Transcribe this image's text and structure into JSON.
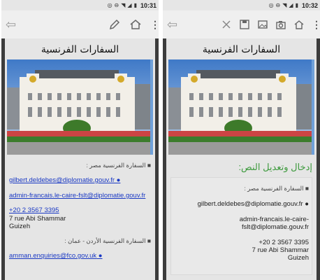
{
  "status": {
    "left_time": "10:31",
    "right_time": "10:32"
  },
  "left": {
    "title": "السفارات الفرنسية",
    "egypt_label": "■ السفارة الفرنسية مصر :",
    "email1": "gilbert.deldebes@diplomatie.gouv.fr",
    "email2": "admin-francais.le-caire-fslt@diplomatie.gouv.fr",
    "phone": "+20 2 3567 3395",
    "address1": "7 rue Abi Shammar",
    "address2": "Guizeh",
    "jordan_label": "■ السفارة الفرنسية الأردن - عمان :",
    "email3": "amman.enquiries@fco.gov.uk"
  },
  "right": {
    "title": "السفارات الفرنسية",
    "edit_title": "إدخال وتعديل النص:",
    "egypt_label": "■ السفارة الفرنسية مصر :",
    "email1": "gilbert.deldebes@diplomatie.gouv.fr ●",
    "email2_line1": "admin-francais.le-caire-",
    "email2_line2": "fslt@diplomatie.gouv.fr",
    "phone": "+20 2 3567 3395",
    "address1": "7 rue Abi Shammar",
    "address2": "Guizeh"
  },
  "icons": {
    "back": "back-arrow-icon",
    "pen": "pen-icon",
    "home": "home-icon",
    "menu": "more-vert-icon",
    "close": "close-icon",
    "save": "save-icon",
    "image": "image-icon",
    "camera": "camera-icon"
  }
}
